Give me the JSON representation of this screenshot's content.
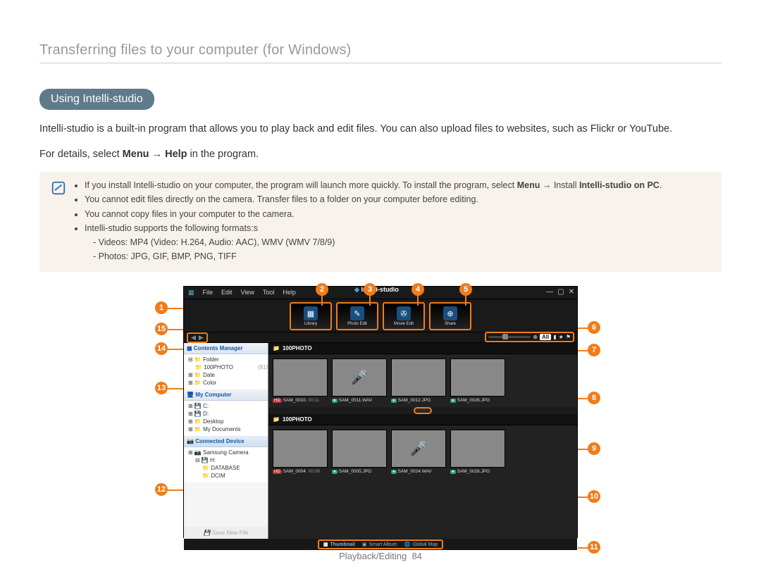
{
  "page_heading": "Transferring files to your computer (for Windows)",
  "pill": "Using Intelli-studio",
  "intro_line1": "Intelli-studio is a built-in program that allows you to play back and edit files. You can also upload files to websites, such as Flickr or YouTube.",
  "intro_line2_a": "For details, select ",
  "intro_line2_b": "Menu",
  "intro_line2_arrow": " → ",
  "intro_line2_c": "Help",
  "intro_line2_d": " in the program.",
  "notes": {
    "n1_a": "If you install Intelli-studio on your computer, the program will launch more quickly. To install the program, select ",
    "n1_b": "Menu",
    "n1_arrow": " → ",
    "n1_c": "Install ",
    "n1_d": "Intelli-studio on PC",
    "n1_e": ".",
    "n2": "You cannot edit files directly on the camera. Transfer files to a folder on your computer before editing.",
    "n3": "You cannot copy files in your computer to the camera.",
    "n4": "Intelli-studio supports the following formats:s",
    "n4a": "- Videos: MP4 (Video: H.264, Audio: AAC), WMV (WMV 7/8/9)",
    "n4b": "- Photos: JPG, GIF, BMP, PNG, TIFF"
  },
  "callouts": {
    "c1": "1",
    "c2": "2",
    "c3": "3",
    "c4": "4",
    "c5": "5",
    "c6": "6",
    "c7": "7",
    "c8": "8",
    "c9": "9",
    "c10": "10",
    "c11": "11",
    "c12": "12",
    "c13": "13",
    "c14": "14",
    "c15": "15"
  },
  "app": {
    "menu": {
      "file": "File",
      "edit": "Edit",
      "view": "View",
      "tool": "Tool",
      "help": "Help"
    },
    "logo": "Intelli-studio",
    "win": {
      "min": "—",
      "max": "▢",
      "close": "✕"
    },
    "modes": {
      "library": "Library",
      "photo": "Photo Edit",
      "movie": "Movie Edit",
      "share": "Share"
    },
    "toolstrip": {
      "back": "◀",
      "fwd": "▶",
      "all": "All"
    },
    "sidebar": {
      "contents_hd": "Contents Manager",
      "folder": "Folder",
      "photo_folder": "100PHOTO",
      "photo_count": "(91)",
      "date": "Date",
      "color": "Color",
      "mycomp_hd": "My Computer",
      "drive_c": "C:",
      "drive_d": "D:",
      "desktop": "Desktop",
      "mydocs": "My Documents",
      "connected_hd": "Connected Device",
      "camera": "Samsung Camera",
      "drive_h": "H:",
      "database": "DATABASE",
      "dcim": "DCIM",
      "save_new": "Save New File"
    },
    "folder_label": "100PHOTO",
    "thumbs_top": [
      {
        "badge": "HD",
        "badgeClass": "b-hd",
        "name": "SAM_0010.",
        "time": "00:11",
        "imgClass": "t-green"
      },
      {
        "badge": "●",
        "badgeClass": "b-wav",
        "name": "SAM_0011.WAV",
        "time": "",
        "imgClass": "t-grey"
      },
      {
        "badge": "●",
        "badgeClass": "b-jpg",
        "name": "SAM_0012.JPG",
        "time": "",
        "imgClass": "t-wall"
      },
      {
        "badge": "●",
        "badgeClass": "b-jpg",
        "name": "SAM_0026.JPG",
        "time": "",
        "imgClass": "t-sunset"
      }
    ],
    "thumbs_bottom": [
      {
        "badge": "HD",
        "badgeClass": "b-hd",
        "name": "SAM_0004.",
        "time": "00:08",
        "imgClass": "t-green2"
      },
      {
        "badge": "●",
        "badgeClass": "b-jpg",
        "name": "SAM_0005.JPG",
        "time": "",
        "imgClass": "t-statue"
      },
      {
        "badge": "●",
        "badgeClass": "b-wav",
        "name": "SAM_0024.WAV",
        "time": "",
        "imgClass": "t-grey"
      },
      {
        "badge": "●",
        "badgeClass": "b-jpg",
        "name": "SAM_0026.JPG",
        "time": "",
        "imgClass": "t-rail"
      }
    ],
    "views": {
      "thumb": "Thumbnail",
      "smart": "Smart Album",
      "map": "Global Map"
    }
  },
  "footer_section": "Playback/Editing",
  "footer_page": "84"
}
